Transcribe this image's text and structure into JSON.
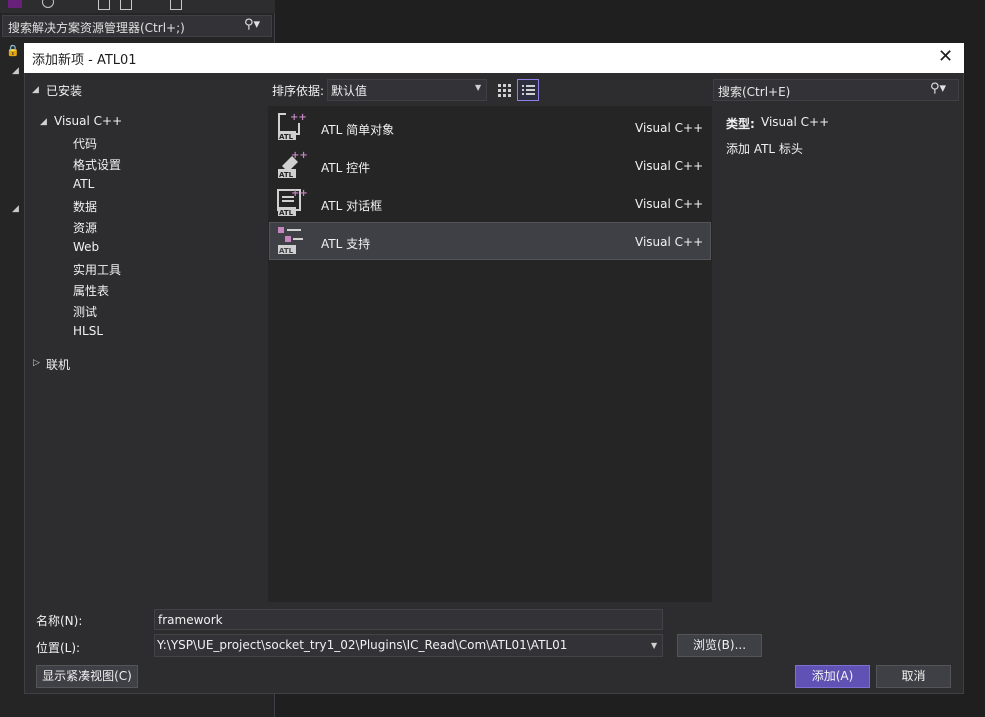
{
  "background": {
    "solution_search_placeholder": "搜索解决方案资源管理器(Ctrl+;)"
  },
  "dialog": {
    "title": "添加新项 - ATL01",
    "tree": {
      "installed": "已安装",
      "visual_cpp": "Visual C++",
      "children": [
        "代码",
        "格式设置",
        "ATL",
        "数据",
        "资源",
        "Web",
        "实用工具",
        "属性表",
        "测试",
        "HLSL"
      ],
      "online": "联机"
    },
    "sort": {
      "label": "排序依据:",
      "value": "默认值"
    },
    "templates": [
      {
        "name": "ATL 简单对象",
        "lang": "Visual C++",
        "icon": "atl-simple-object-icon"
      },
      {
        "name": "ATL 控件",
        "lang": "Visual C++",
        "icon": "atl-control-icon"
      },
      {
        "name": "ATL 对话框",
        "lang": "Visual C++",
        "icon": "atl-dialog-icon"
      },
      {
        "name": "ATL 支持",
        "lang": "Visual C++",
        "icon": "atl-support-icon",
        "selected": true
      }
    ],
    "search_placeholder": "搜索(Ctrl+E)",
    "details": {
      "type_label": "类型:",
      "type_value": "Visual C++",
      "description": "添加 ATL 标头"
    },
    "name_label": "名称(N):",
    "name_value": "framework",
    "location_label": "位置(L):",
    "location_value": "Y:\\YSP\\UE_project\\socket_try1_02\\Plugins\\IC_Read\\Com\\ATL01\\ATL01",
    "browse_button": "浏览(B)...",
    "compact_view_button": "显示紧凑视图(C)",
    "add_button": "添加(A)",
    "cancel_button": "取消"
  },
  "colors": {
    "accent": "#5f52b4",
    "atl_icon_purple": "#c586c0"
  }
}
